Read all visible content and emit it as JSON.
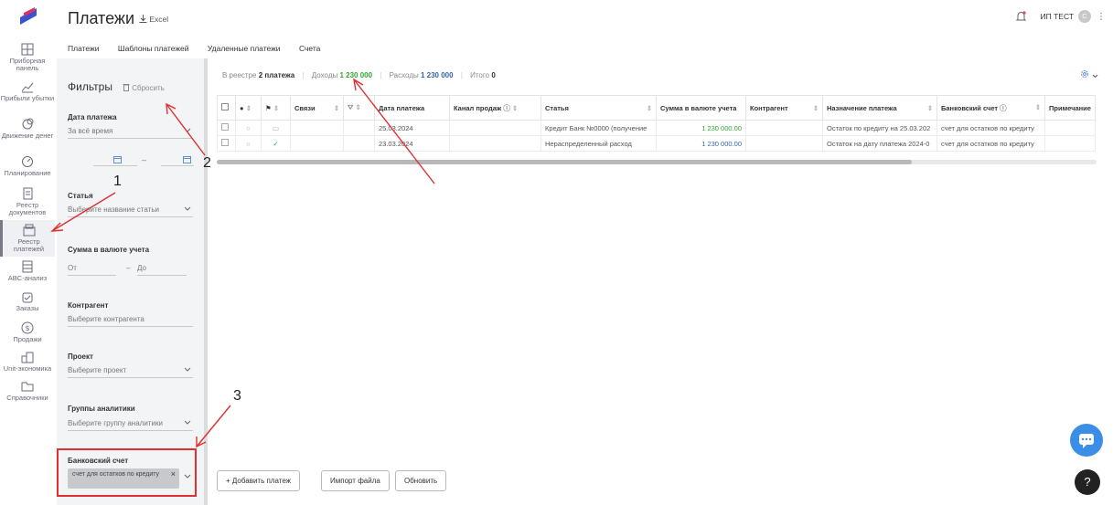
{
  "rail": [
    {
      "label": "Приборная панель",
      "icon": "dashboard-icon"
    },
    {
      "label": "Прибыли убытки",
      "icon": "profit-chart-icon"
    },
    {
      "label": "Движение денег",
      "icon": "money-flow-icon"
    },
    {
      "label": "Планирование",
      "icon": "planning-icon"
    },
    {
      "label": "Реестр документов",
      "icon": "documents-icon"
    },
    {
      "label": "Реестр платежей",
      "icon": "payments-registry-icon"
    },
    {
      "label": "ABC-анализ",
      "icon": "abc-icon"
    },
    {
      "label": "Заказы",
      "icon": "orders-icon"
    },
    {
      "label": "Продажи",
      "icon": "sales-icon"
    },
    {
      "label": "Unit-экономика",
      "icon": "unit-economy-icon"
    },
    {
      "label": "Справочники",
      "icon": "folder-icon"
    }
  ],
  "header": {
    "title": "Платежи",
    "excel": "Excel",
    "user": "ИП ТЕСТ",
    "avatar": "С"
  },
  "tabs": [
    "Платежи",
    "Шаблоны платежей",
    "Удаленные платежи",
    "Счета"
  ],
  "filters": {
    "title": "Фильтры",
    "reset": "Сбросить",
    "date_label": "Дата платежа",
    "date_value": "За всё время",
    "date_sep": "–",
    "article_label": "Статья",
    "article_placeholder": "Выберите название статьи",
    "sum_label": "Сумма в валюте учета",
    "sum_from": "От",
    "sum_to": "До",
    "sum_sep": "–",
    "contractor_label": "Контрагент",
    "contractor_placeholder": "Выберите контрагента",
    "project_label": "Проект",
    "project_placeholder": "Выберите проект",
    "groups_label": "Группы аналитики",
    "groups_placeholder": "Выберите группу аналитики",
    "bank_label": "Банковский счет",
    "bank_chip": "счет для остатков по кредиту",
    "bank_chip_close": "×"
  },
  "summary": {
    "registry_prefix": "В реестре",
    "registry_value": "2 платежа",
    "income_label": "Доходы",
    "income_value": "1 230 000",
    "expense_label": "Расходы",
    "expense_value": "1 230 000",
    "total_label": "Итого",
    "total_value": "0"
  },
  "table": {
    "headers": [
      "Связи",
      "Дата платежа",
      "Канал продаж",
      "Статья",
      "Сумма в валюте учета",
      "Контрагент",
      "Назначение платежа",
      "Банковский счет",
      "Примечание"
    ],
    "rows": [
      {
        "date": "25.03.2024",
        "article": "Кредит Банк №0000 (получение",
        "sum": "1 230 000.00",
        "purpose": "Остаток по кредиту на 25.03.202",
        "bank": "счет для остатков по кредиту"
      },
      {
        "date": "23.03.2024",
        "article": "Нераспределенный расход",
        "sum": "1 230 000.00",
        "purpose": "Остаток на дату платежа 2024-0",
        "bank": "счет для остатков по кредиту"
      }
    ]
  },
  "buttons": {
    "add": "+ Добавить платеж",
    "import": "Импорт файла",
    "refresh": "Обновить"
  },
  "annotations": [
    "1",
    "2",
    "3"
  ],
  "colors": {
    "green": "#2ea82e",
    "blue": "#3565a8",
    "red": "#e03030"
  }
}
